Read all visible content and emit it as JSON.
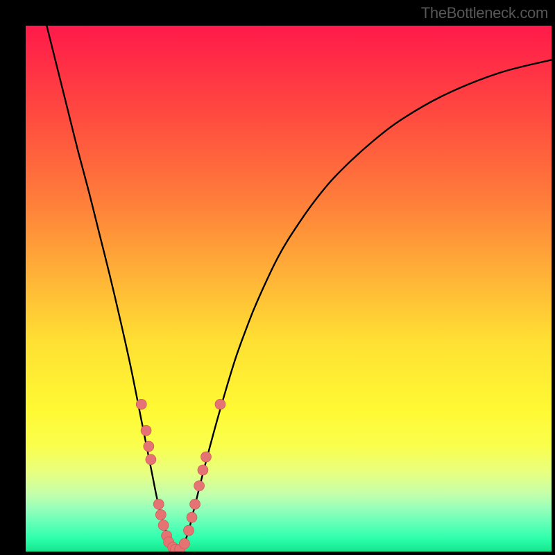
{
  "watermark": "TheBottleneck.com",
  "colors": {
    "curve": "#000000",
    "marker_fill": "#e57373",
    "marker_stroke": "#c94f4f"
  },
  "chart_data": {
    "type": "line",
    "title": "",
    "xlabel": "",
    "ylabel": "",
    "xlim": [
      0,
      100
    ],
    "ylim": [
      0,
      100
    ],
    "grid": false,
    "annotations": [],
    "series": [
      {
        "name": "curve",
        "x": [
          4,
          6,
          8,
          10,
          12,
          14,
          16,
          18,
          20,
          22,
          23,
          24,
          25,
          26,
          27,
          28,
          29,
          30,
          31,
          32,
          34,
          36,
          38,
          40,
          42,
          44,
          48,
          52,
          56,
          60,
          66,
          72,
          80,
          90,
          100
        ],
        "y": [
          100,
          92,
          84,
          76,
          68.5,
          60.5,
          52.5,
          44,
          35,
          25,
          20,
          15,
          10,
          6,
          3,
          1,
          0.3,
          1.3,
          4,
          8,
          16,
          23.5,
          30.5,
          37,
          42.5,
          47.5,
          56,
          62.5,
          68,
          72.5,
          78,
          82.5,
          87,
          91,
          93.5
        ]
      },
      {
        "name": "markers",
        "x": [
          22.0,
          22.9,
          23.4,
          23.8,
          25.3,
          25.7,
          26.2,
          26.8,
          27.2,
          28.0,
          28.5,
          29.3,
          30.2,
          31.0,
          31.6,
          32.2,
          33.0,
          33.7,
          34.3,
          37.0
        ],
        "y": [
          28.0,
          23.0,
          20.0,
          17.5,
          9.0,
          7.0,
          5.0,
          3.0,
          1.8,
          0.8,
          0.4,
          0.4,
          1.5,
          4.0,
          6.5,
          9.0,
          12.5,
          15.5,
          18.0,
          28.0
        ]
      }
    ]
  }
}
